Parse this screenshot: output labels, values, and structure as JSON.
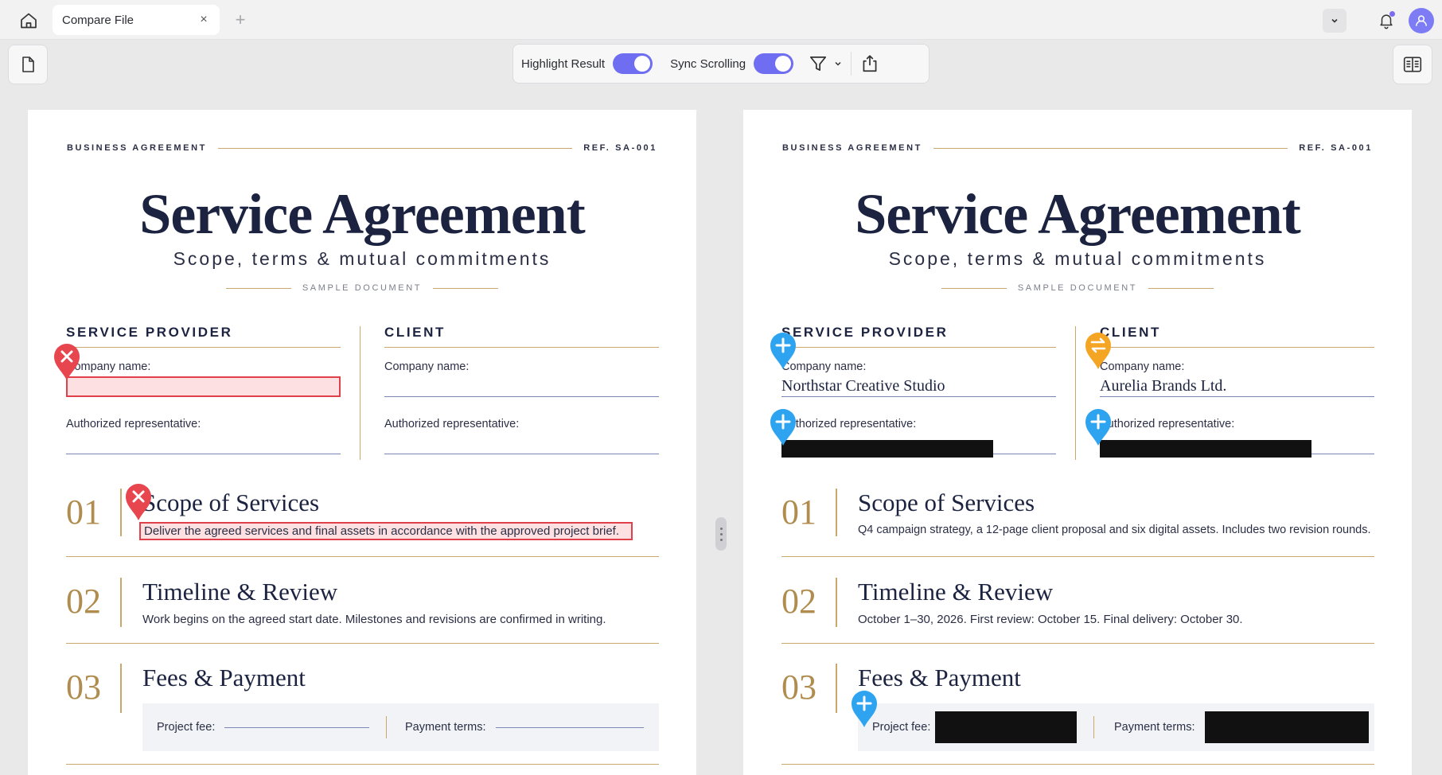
{
  "titlebar": {
    "tab_label": "Compare File",
    "tab_close": "×",
    "tab_add": "+"
  },
  "toolbar": {
    "highlight_label": "Highlight Result",
    "highlight_on": true,
    "sync_label": "Sync Scrolling",
    "sync_on": true
  },
  "colors": {
    "accent": "#6f6ef2",
    "deleted": "#e0404a",
    "added": "#2ea4f0",
    "changed": "#f5a524",
    "gold": "#c9a96b",
    "navy": "#1c2340"
  },
  "left_doc": {
    "header_left": "BUSINESS AGREEMENT",
    "header_right": "REF. SA-001",
    "title": "Service Agreement",
    "subtitle": "Scope, terms & mutual commitments",
    "sample": "SAMPLE DOCUMENT",
    "provider_title": "SERVICE PROVIDER",
    "client_title": "CLIENT",
    "company_label": "Company name:",
    "rep_label": "Authorized representative:",
    "provider_company": "",
    "client_company": "",
    "sections": [
      {
        "num": "01",
        "title": "Scope of Services",
        "body": "Deliver the agreed services and final assets in accordance with the approved project brief."
      },
      {
        "num": "02",
        "title": "Timeline & Review",
        "body": "Work begins on the agreed start date. Milestones and revisions are confirmed in writing."
      },
      {
        "num": "03",
        "title": "Fees & Payment",
        "fee_label": "Project fee:",
        "terms_label": "Payment terms:"
      }
    ]
  },
  "right_doc": {
    "header_left": "BUSINESS AGREEMENT",
    "header_right": "REF. SA-001",
    "title": "Service Agreement",
    "subtitle": "Scope, terms & mutual commitments",
    "sample": "SAMPLE DOCUMENT",
    "provider_title": "SERVICE PROVIDER",
    "client_title": "CLIENT",
    "company_label": "Company name:",
    "rep_label": "Authorized representative:",
    "provider_company": "Northstar Creative Studio",
    "client_company": "Aurelia Brands Ltd.",
    "sections": [
      {
        "num": "01",
        "title": "Scope of Services",
        "body": "Q4 campaign strategy, a 12-page client proposal and six digital assets. Includes two revision rounds."
      },
      {
        "num": "02",
        "title": "Timeline & Review",
        "body": "October 1–30, 2026. First review: October 15. Final delivery: October 30."
      },
      {
        "num": "03",
        "title": "Fees & Payment",
        "fee_label": "Project fee:",
        "terms_label": "Payment terms:"
      }
    ]
  }
}
